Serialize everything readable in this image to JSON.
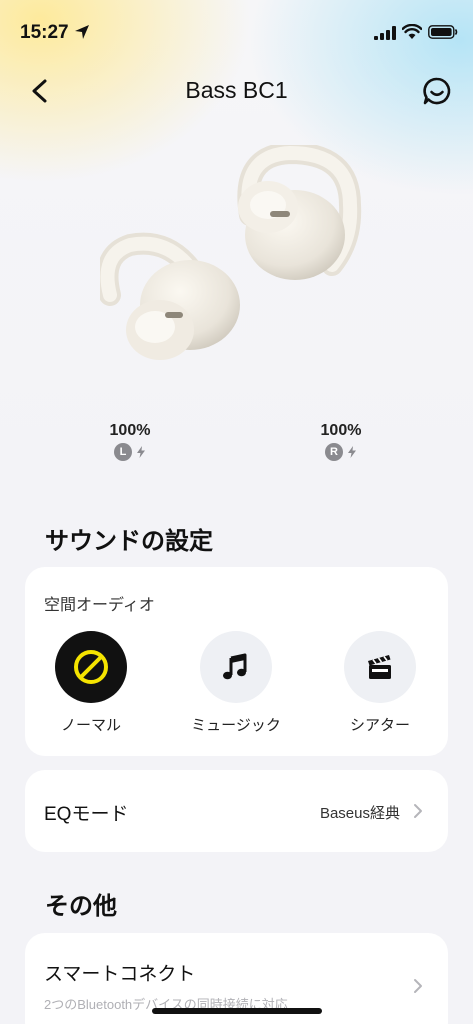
{
  "status_bar": {
    "time": "15:27"
  },
  "nav": {
    "title": "Bass BC1"
  },
  "battery": {
    "left": {
      "percent": "100%",
      "side": "L"
    },
    "right": {
      "percent": "100%",
      "side": "R"
    }
  },
  "sound_settings": {
    "title": "サウンドの設定",
    "spatial_audio": {
      "label": "空間オーディオ",
      "modes": [
        {
          "label": "ノーマル",
          "icon": "disabled-icon",
          "selected": true
        },
        {
          "label": "ミュージック",
          "icon": "music-note-icon",
          "selected": false
        },
        {
          "label": "シアター",
          "icon": "clapperboard-icon",
          "selected": false
        }
      ]
    },
    "eq": {
      "label": "EQモード",
      "value": "Baseus経典"
    }
  },
  "other": {
    "title": "その他",
    "smart_connect": {
      "label": "スマートコネクト",
      "description": "2つのBluetoothデバイスの同時接続に対応"
    }
  },
  "colors": {
    "accent_yellow": "#f5e400",
    "active_black": "#111111",
    "card_bg": "#ffffff",
    "page_bg": "#f3f3f7"
  }
}
